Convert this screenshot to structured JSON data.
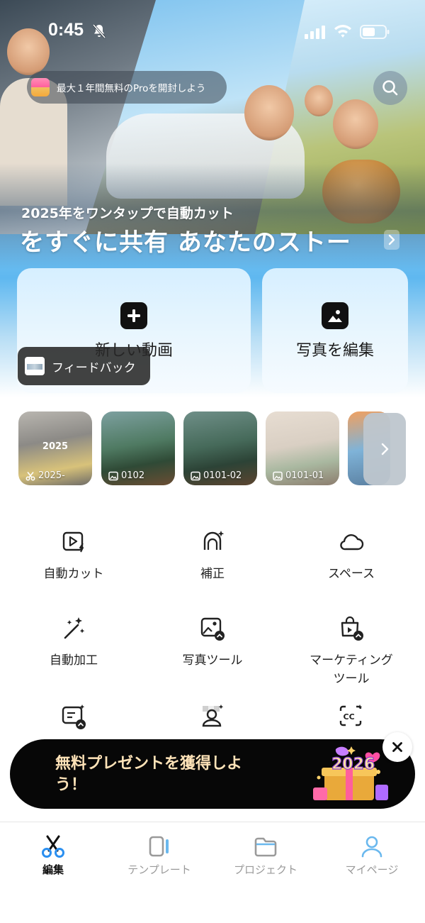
{
  "status_bar": {
    "time": "0:45"
  },
  "hero": {
    "promo_text": "最大１年間無料のProを開封しよう",
    "subtitle": "2025年をワンタップで自動カット",
    "title": "をすぐに共有  あなたのストー"
  },
  "actions": {
    "new_video": "新しい動画",
    "edit_photo": "写真を編集"
  },
  "feedback_label": "フィードバック",
  "drafts": [
    {
      "overlay": "2025",
      "label": "2025-",
      "kind": "video"
    },
    {
      "label": "0102",
      "kind": "photo"
    },
    {
      "label": "0101-02",
      "kind": "photo"
    },
    {
      "label": "0101-01",
      "kind": "photo"
    }
  ],
  "tools": [
    {
      "label": "自動カット",
      "icon": "auto-cut-icon"
    },
    {
      "label": "補正",
      "icon": "retouch-icon"
    },
    {
      "label": "スペース",
      "icon": "cloud-icon"
    },
    {
      "label": "自動加工",
      "icon": "magic-wand-icon"
    },
    {
      "label": "写真ツール",
      "icon": "photo-tools-icon"
    },
    {
      "label": "マーケティング\nツール",
      "icon": "marketing-tools-icon"
    }
  ],
  "banner": {
    "text": "無料プレゼントを獲得しよう！",
    "art_text": "2026"
  },
  "tabs": [
    {
      "label": "編集",
      "icon": "scissors-icon",
      "active": true
    },
    {
      "label": "テンプレート",
      "icon": "template-icon",
      "active": false
    },
    {
      "label": "プロジェクト",
      "icon": "folder-icon",
      "active": false
    },
    {
      "label": "マイページ",
      "icon": "profile-icon",
      "active": false
    }
  ],
  "colors": {
    "accent_blue": "#2b8ff0",
    "banner_text": "#ffe3b8",
    "active_tab": "#111111",
    "inactive_tab": "#9a9a9a"
  }
}
